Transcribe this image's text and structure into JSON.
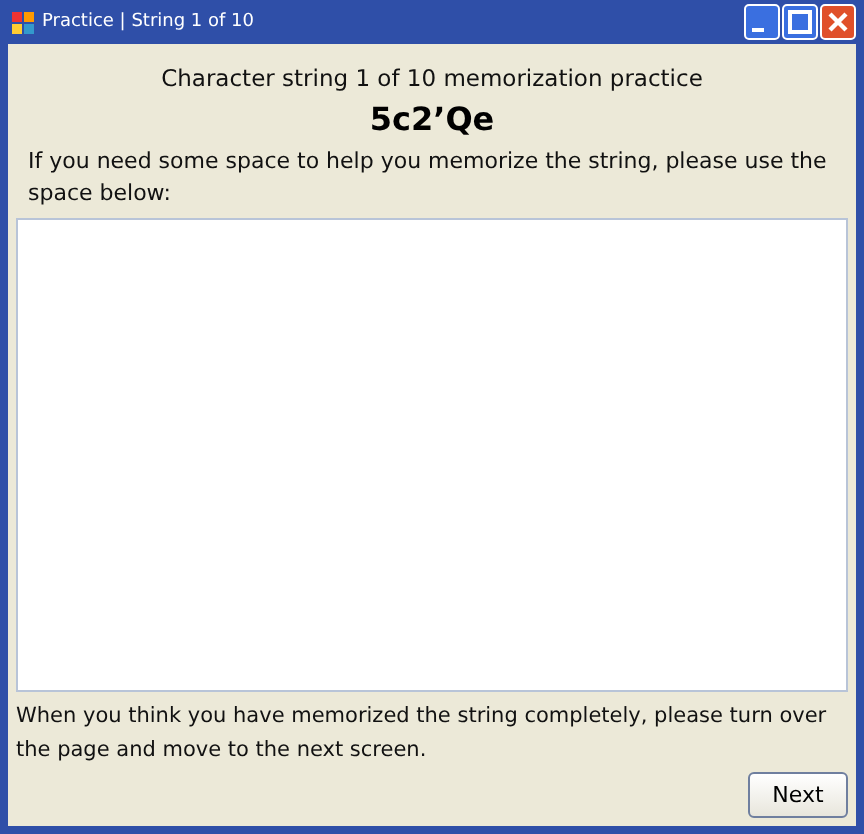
{
  "window": {
    "title": "Practice | String 1 of 10"
  },
  "heading": "Character string 1 of 10 memorization practice",
  "target_string": "5c2’Qe",
  "instruction": "If you need some space to help you memorize the string, please use the space below:",
  "footer_text": "When you think you have memorized the string completely, please turn over the page and move to the next screen.",
  "buttons": [
    "Next"
  ]
}
